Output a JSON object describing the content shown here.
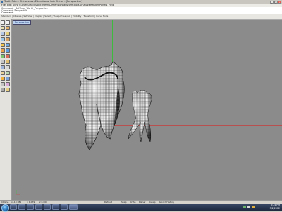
{
  "window": {
    "title": "Tooth.3dm - Rhinoceros (Educational Lab Rhino) - [Perspective]",
    "controls": [
      "_",
      "□",
      "×"
    ]
  },
  "menu": [
    "File",
    "Edit",
    "View",
    "Curve",
    "Surface",
    "Solid",
    "Mesh",
    "Dimension",
    "Transform",
    "Tools",
    "Analyze",
    "Render",
    "Panels",
    "Help"
  ],
  "command_history": [
    "Command: _SetView _World _Perspective",
    "Command: Perspective"
  ],
  "command_prompt": "Command:",
  "toolbar": {
    "tabs_label": "Standard | CPlanes | Set View | Display | Select | Viewport Layout | Visibility | Transform | Curve Tools"
  },
  "viewport": {
    "label": "Perspective",
    "background": "#8b8b8b",
    "axis_labels": [
      "z",
      "y",
      "x"
    ]
  },
  "status": {
    "cplane": "CPlane",
    "x": "x -10.981",
    "y": "y 1.079",
    "z": "z 0.000",
    "layer": "Default",
    "snap": "Snap",
    "ortho": "Ortho",
    "planar": "Planar",
    "osnap": "Osnap",
    "record": "Record History"
  },
  "taskbar": {
    "time": "6:24 PM",
    "date": "5/2/2012"
  },
  "colors": {
    "green_axis": "#3dbb3d",
    "red_axis": "#b85050"
  }
}
